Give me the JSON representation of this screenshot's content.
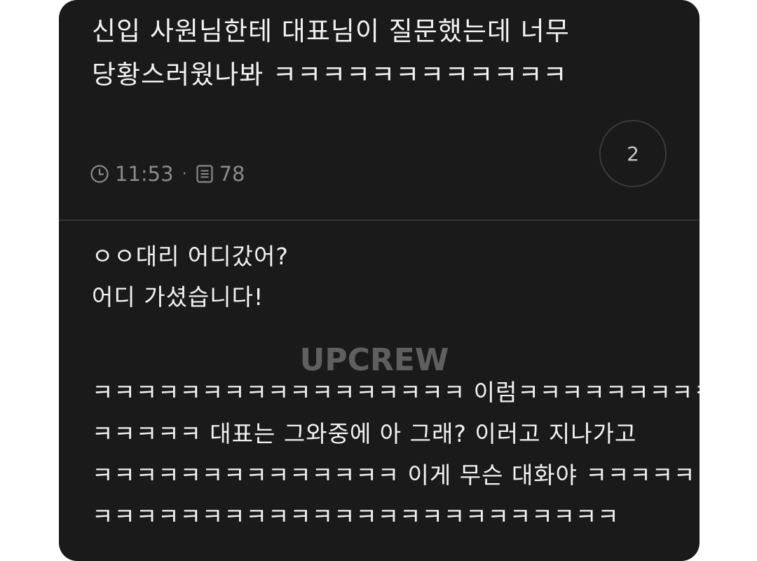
{
  "post": {
    "title": "신입 사원님한테 대표님이 질문했는데 너무\n당황스러웠나봐 ㅋㅋㅋㅋㅋㅋㅋㅋㅋㅋㅋㅋ",
    "time": "11:53",
    "separator": "·",
    "views": "78",
    "comment_count": "2"
  },
  "body": {
    "lines": [
      "ㅇㅇ대리 어디갔어?",
      "어디 가셨습니다!",
      "ㅋㅋㅋㅋㅋㅋㅋㅋㅋㅋㅋㅋㅋㅋㅋㅋㅋ 이럼ㅋㅋㅋㅋㅋㅋㅋㅋㅋㅋ",
      "ㅋㅋㅋㅋㅋ 대표는 그와중에 아 그래? 이러고 지나가고",
      "ㅋㅋㅋㅋㅋㅋㅋㅋㅋㅋㅋㅋㅋㅋ 이게 무슨 대화야 ㅋㅋㅋㅋㅋㅋ",
      "ㅋㅋㅋㅋㅋㅋㅋㅋㅋㅋㅋㅋㅋㅋㅋㅋㅋㅋㅋㅋㅋㅋㅋㅋ"
    ]
  },
  "watermark": "UPCREW",
  "icons": {
    "time": "clock-icon",
    "views": "document-icon"
  },
  "colors": {
    "card_background": "#1a1a1a",
    "text_primary": "#f2f2f2",
    "text_secondary": "#8a8a8a"
  }
}
